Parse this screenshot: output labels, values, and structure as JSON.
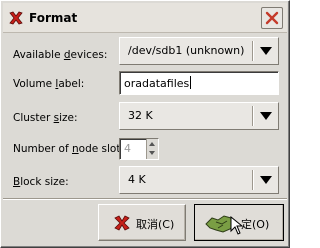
{
  "window": {
    "title": "Format",
    "close_icon": "close-icon",
    "app_icon": "format-x-icon"
  },
  "form": {
    "devices": {
      "label_pre": "Available ",
      "label_u": "d",
      "label_post": "evices:",
      "value": "/dev/sdb1 (unknown)"
    },
    "volume": {
      "label_pre": "Volume ",
      "label_u": "l",
      "label_post": "abel:",
      "value": "oradatafiles"
    },
    "cluster": {
      "label_pre": "Cluster ",
      "label_u": "s",
      "label_post": "ize:",
      "value": "32 K"
    },
    "nodes": {
      "label_pre": "Number of ",
      "label_u": "n",
      "label_post": "ode slots:",
      "value": "4"
    },
    "block": {
      "label_pre": "",
      "label_u": "B",
      "label_post": "lock size:",
      "value": "4 K"
    }
  },
  "buttons": {
    "cancel_label": "取消(C)",
    "ok_label": "定(O)"
  }
}
